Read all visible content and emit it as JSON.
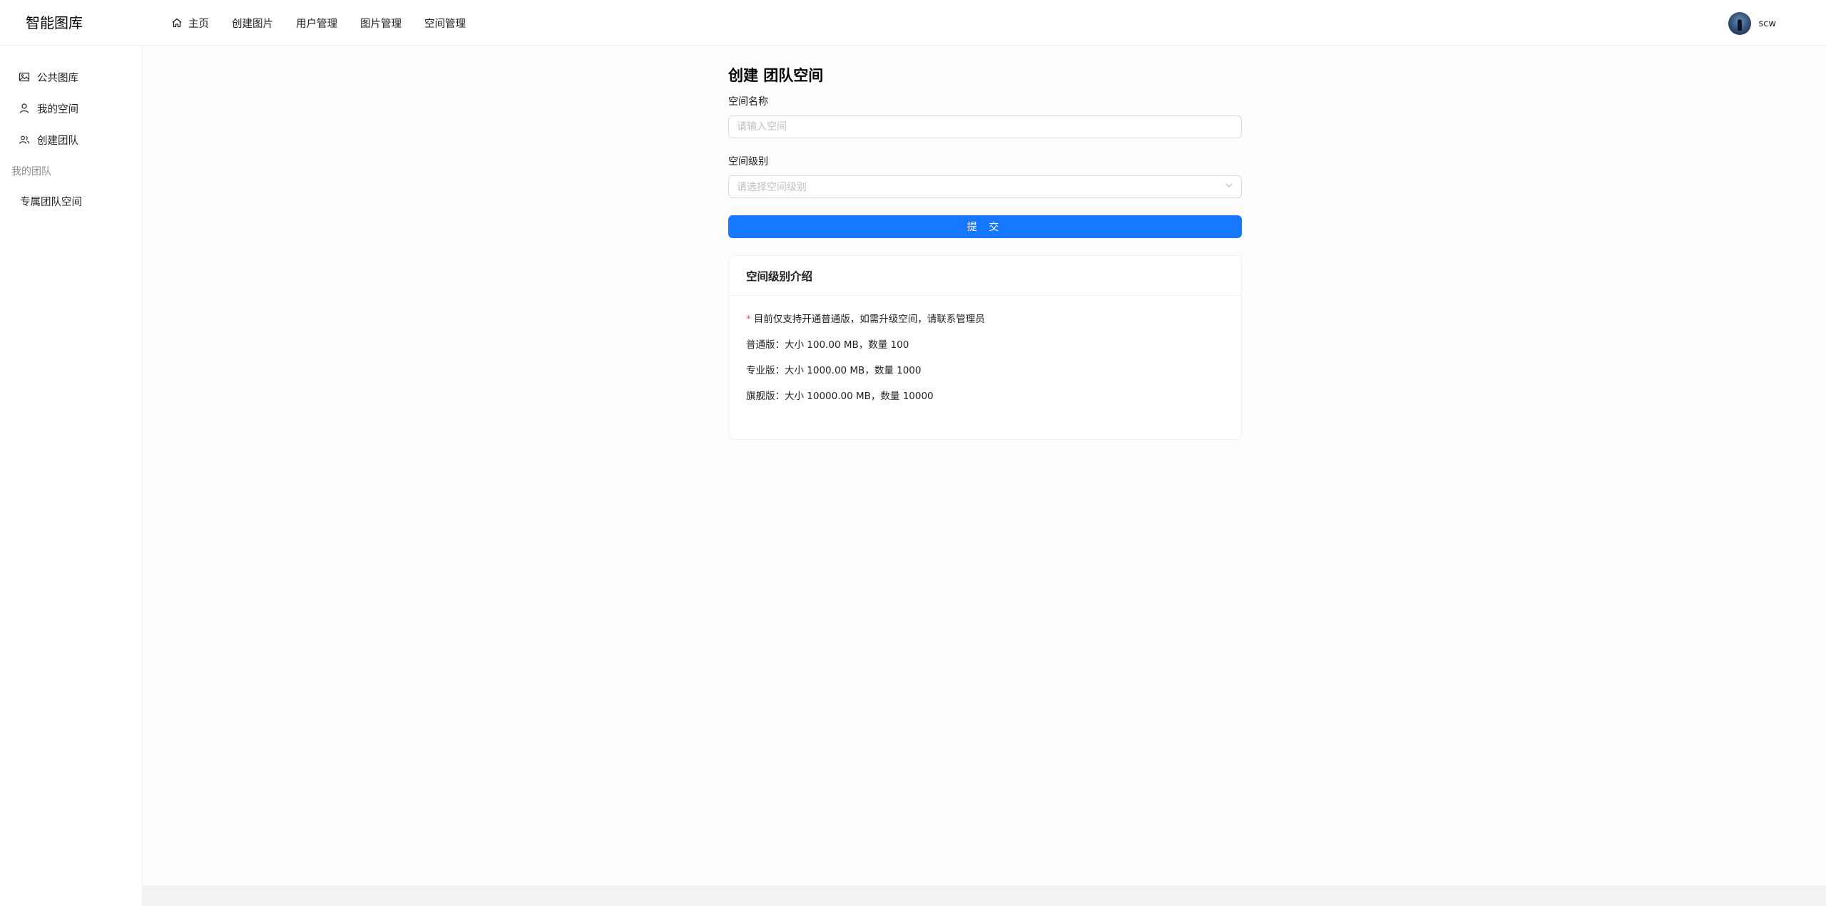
{
  "header": {
    "logo": "智能图库",
    "nav": [
      {
        "label": "主页",
        "icon": "home-icon"
      },
      {
        "label": "创建图片"
      },
      {
        "label": "用户管理"
      },
      {
        "label": "图片管理"
      },
      {
        "label": "空间管理"
      }
    ],
    "username": "scw"
  },
  "sider": {
    "items": [
      {
        "label": "公共图库",
        "icon": "picture-icon"
      },
      {
        "label": "我的空间",
        "icon": "user-icon"
      },
      {
        "label": "创建团队",
        "icon": "team-icon"
      }
    ],
    "group_title": "我的团队",
    "group_items": [
      {
        "label": "专属团队空间"
      }
    ]
  },
  "form": {
    "title": "创建 团队空间",
    "name_label": "空间名称",
    "name_placeholder": "请输入空间",
    "level_label": "空间级别",
    "level_placeholder": "请选择空间级别",
    "submit_label": "提 交"
  },
  "levels_card": {
    "title": "空间级别介绍",
    "note_star": "*",
    "note": "目前仅支持开通普通版，如需升级空间，请联系管理员",
    "levels": [
      {
        "text": "普通版：大小 100.00 MB，数量 100"
      },
      {
        "text": "专业版：大小 1000.00 MB，数量 1000"
      },
      {
        "text": "旗舰版：大小 10000.00 MB，数量 10000"
      }
    ]
  },
  "colors": {
    "primary": "#1677ff",
    "required_star": "#ff4d4f",
    "border": "#d9d9d9"
  }
}
